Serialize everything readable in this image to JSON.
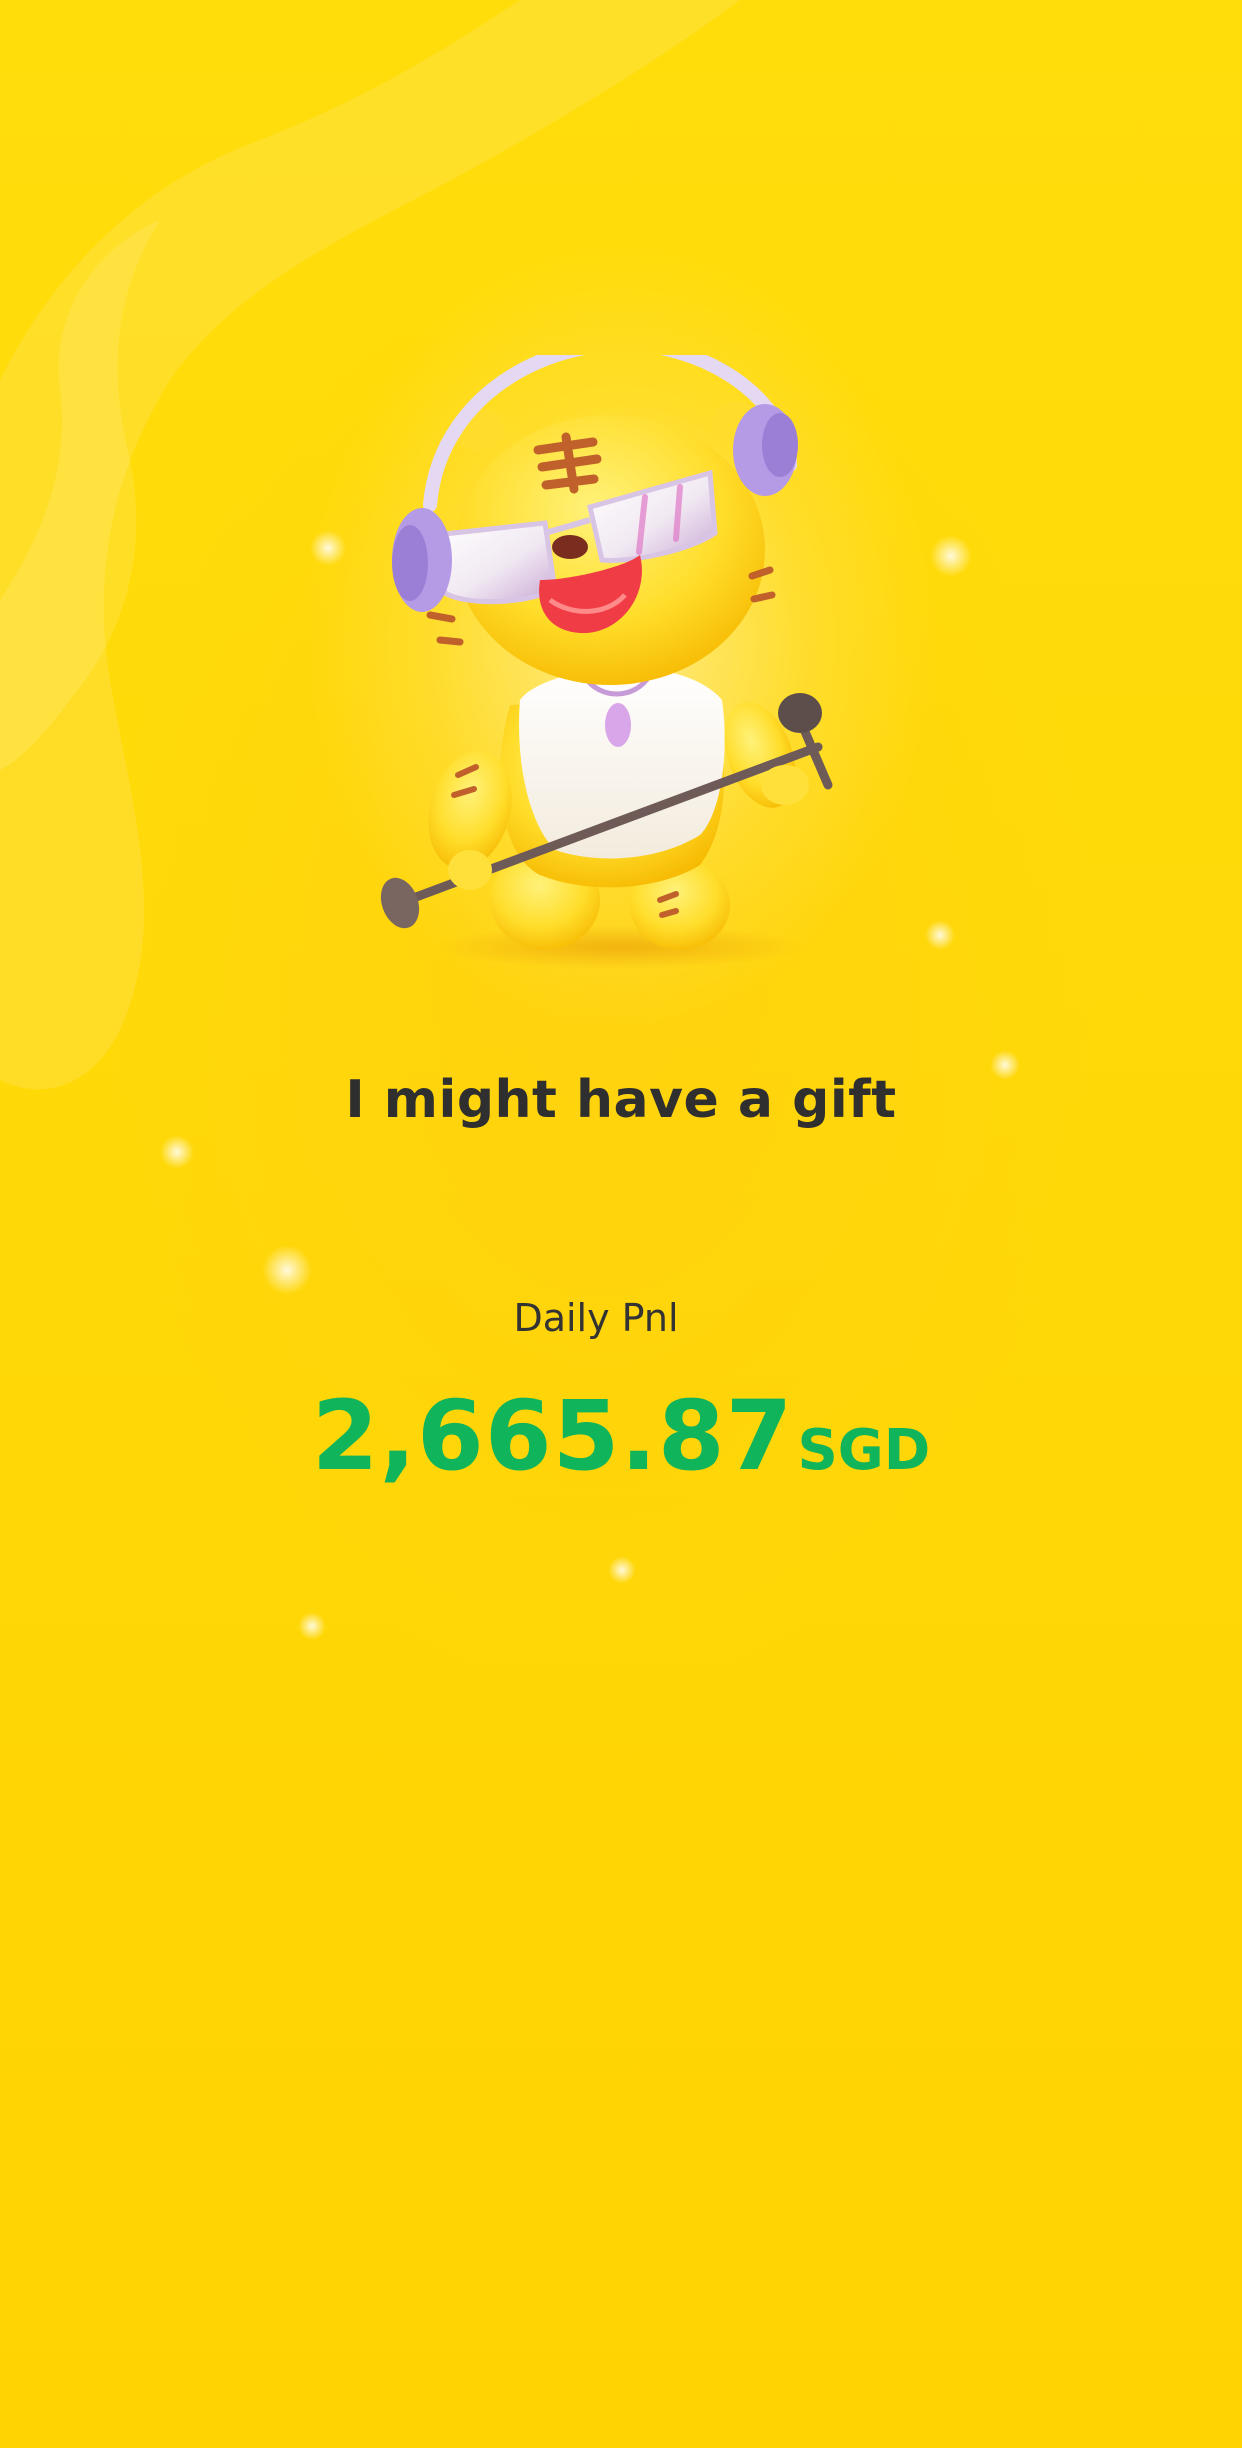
{
  "message": {
    "title": "I might have a gift"
  },
  "pnl": {
    "label": "Daily Pnl",
    "value": "2,665.87",
    "currency": "SGD"
  },
  "mascot": {
    "icon": "tiger-mascot-singer-icon"
  },
  "colors": {
    "background": "#FFD808",
    "title": "#2F2F2F",
    "pnl_positive": "#10B45A"
  }
}
